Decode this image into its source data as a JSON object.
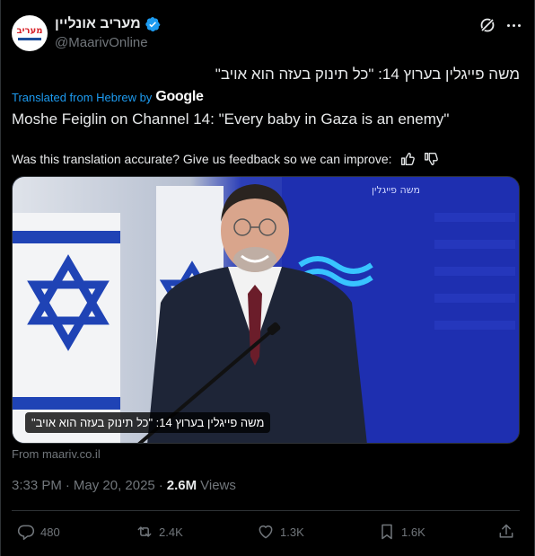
{
  "post": {
    "display_name": "מעריב אונליין",
    "handle": "@MaarivOnline",
    "avatar_text": "מעריב",
    "original_text": "משה פייגלין בערוץ 14: \"כל תינוק בעזה הוא אויב\"",
    "translated_from": "Translated from Hebrew by",
    "translator": "Google",
    "translation": "Moshe Feiglin on Channel 14: \"Every baby in Gaza is an enemy\"",
    "feedback_prompt": "Was this translation accurate? Give us feedback so we can improve:",
    "media_caption": "משה פייגלין בערוץ 14: \"כל תינוק בעזה הוא אויב\"",
    "backdrop_text": "משה פייגלין",
    "source": "From maariv.co.il",
    "time": "3:33 PM",
    "separator": "·",
    "date": "May 20, 2025",
    "views_count": "2.6M",
    "views_label": "Views"
  },
  "actions": {
    "replies": "480",
    "reposts": "2.4K",
    "likes": "1.3K",
    "bookmarks": "1.6K"
  },
  "colors": {
    "accent": "#1d9bf0",
    "muted": "#71767b",
    "text": "#e7e9ea",
    "background": "#000000"
  }
}
